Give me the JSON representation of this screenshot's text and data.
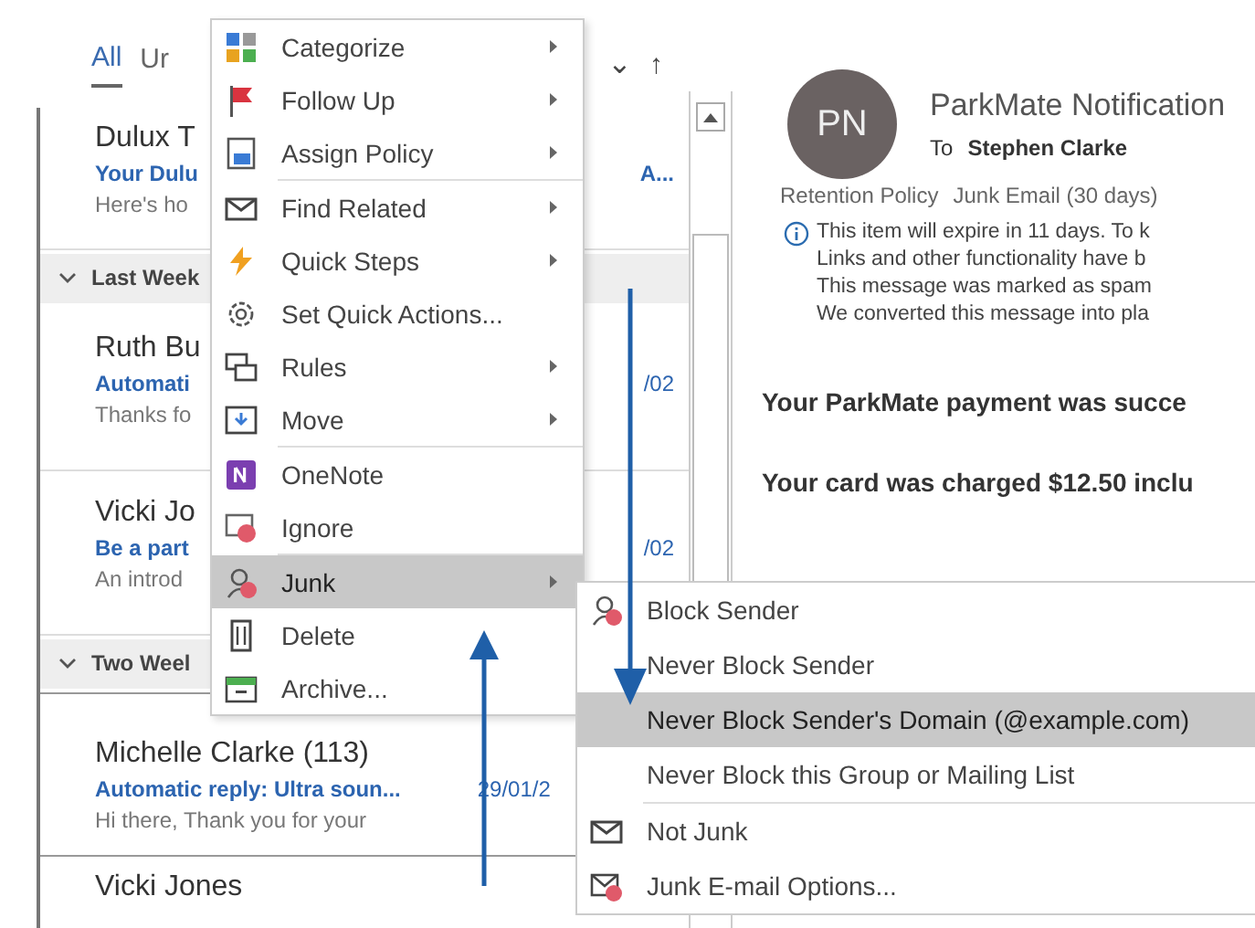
{
  "mail_list": {
    "tabs": [
      {
        "label": "All",
        "selected": true
      },
      {
        "label": "Ur",
        "selected": false
      }
    ],
    "sort_caret": "⌄",
    "sort_direction": "↑",
    "items": [
      {
        "kind": "message",
        "name": "Dulux T",
        "subject": "Your Dulu",
        "subject_tail": "A...",
        "preview": "Here's ho"
      },
      {
        "kind": "group",
        "label": "Last Week",
        "expanded": true
      },
      {
        "kind": "message",
        "name": "Ruth Bu",
        "subject": "Automati",
        "date": "/02",
        "preview": "Thanks fo"
      },
      {
        "kind": "message",
        "name": "Vicki Jo",
        "subject": "Be a part",
        "date": "/02",
        "preview": "An introd"
      },
      {
        "kind": "group",
        "label": "Two Weel",
        "expanded": true
      },
      {
        "kind": "message",
        "name": "Michelle Clarke (113)",
        "subject": "Automatic reply: Ultra soun...",
        "date": "29/01/2",
        "preview": "Hi there,  Thank you for your"
      },
      {
        "kind": "message",
        "name": "Vicki Jones"
      }
    ]
  },
  "reading_pane": {
    "avatar_initials": "PN",
    "sender": "ParkMate Notification",
    "to_label": "To",
    "recipient": "Stephen Clarke",
    "retention_label": "Retention Policy",
    "retention_value": "Junk Email (30 days)",
    "info_lines": [
      "This item will expire in 11 days. To k",
      "Links and other functionality have b",
      "This message was marked as spam",
      "We converted this message into pla"
    ],
    "body": [
      "Your ParkMate payment was succe",
      "Your card was charged $12.50 inclu"
    ]
  },
  "context_menu": {
    "items": [
      {
        "label": "Categorize",
        "submenu": true,
        "selected": false
      },
      {
        "label": "Follow Up",
        "submenu": true,
        "selected": false
      },
      {
        "label": "Assign Policy",
        "submenu": true,
        "selected": false
      },
      {
        "label": "Find Related",
        "submenu": true,
        "selected": false
      },
      {
        "label": "Quick Steps",
        "submenu": true,
        "selected": false
      },
      {
        "label": "Set Quick Actions...",
        "submenu": false,
        "selected": false
      },
      {
        "label": "Rules",
        "submenu": true,
        "selected": false
      },
      {
        "label": "Move",
        "submenu": true,
        "selected": false
      },
      {
        "label": "OneNote",
        "submenu": false,
        "selected": false
      },
      {
        "label": "Ignore",
        "submenu": false,
        "selected": false
      },
      {
        "label": "Junk",
        "submenu": true,
        "selected": true
      },
      {
        "label": "Delete",
        "submenu": false,
        "selected": false
      },
      {
        "label": "Archive...",
        "submenu": false,
        "selected": false
      }
    ]
  },
  "junk_submenu": {
    "items": [
      {
        "label": "Block Sender",
        "selected": false
      },
      {
        "label": "Never Block Sender",
        "selected": false
      },
      {
        "label": "Never Block Sender's Domain (@example.com)",
        "selected": true
      },
      {
        "label": "Never Block this Group or Mailing List",
        "selected": false
      },
      {
        "label": "Not Junk",
        "selected": false
      },
      {
        "label": "Junk E-mail Options...",
        "selected": false
      }
    ]
  }
}
